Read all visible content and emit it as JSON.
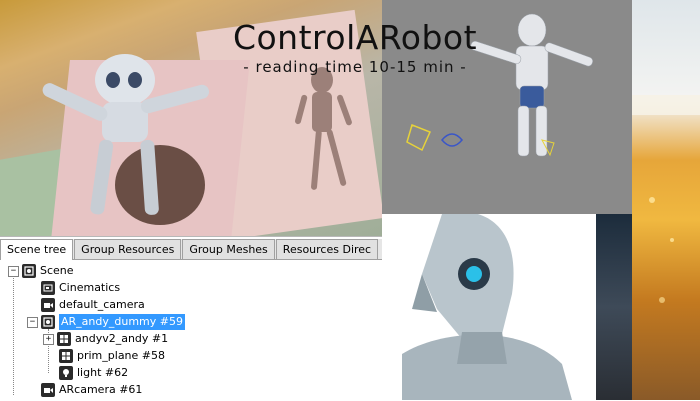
{
  "header": {
    "title": "ControlARobot",
    "subtitle": "- reading time 10-15 min -"
  },
  "scene_panel": {
    "tabs": [
      {
        "label": "Scene tree",
        "active": true
      },
      {
        "label": "Group Resources",
        "active": false
      },
      {
        "label": "Group Meshes",
        "active": false
      },
      {
        "label": "Resources Direc",
        "active": false
      }
    ],
    "tree": {
      "root": {
        "label": "Scene",
        "icon": "scene-icon",
        "expanded": true
      },
      "items": [
        {
          "label": "Cinematics",
          "icon": "cinematics-icon"
        },
        {
          "label": "default_camera",
          "icon": "camera-icon"
        },
        {
          "label": "AR_andy_dummy #59",
          "icon": "dummy-node-icon",
          "selected": true,
          "expanded": true,
          "children": [
            {
              "label": "andyv2_andy #1",
              "icon": "mesh-icon",
              "expandable": true
            },
            {
              "label": "prim_plane #58",
              "icon": "mesh-icon"
            },
            {
              "label": "light #62",
              "icon": "light-icon"
            }
          ]
        },
        {
          "label": "ARcamera #61",
          "icon": "camera-icon"
        }
      ]
    },
    "selection_color": "#3399ff"
  }
}
